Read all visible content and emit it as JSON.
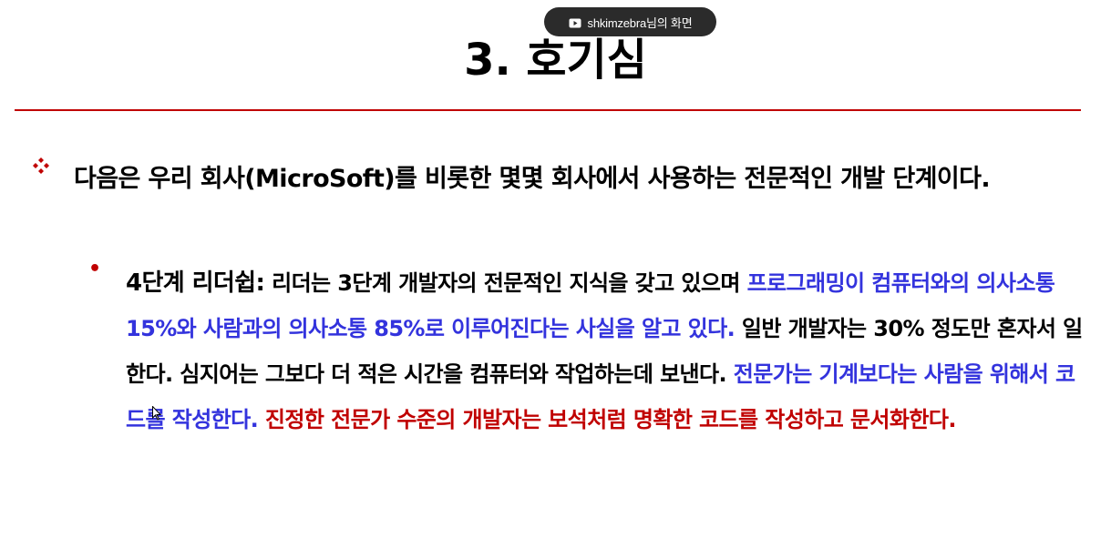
{
  "screen_share": {
    "label": "shkimzebra님의 화면",
    "icon": "screen-share-icon"
  },
  "slide": {
    "title": "3. 호기심",
    "bullet1": {
      "icon": "diamond-bullet-icon",
      "text": "다음은 우리 회사(MicroSoft)를 비롯한 몇몇 회사에서 사용하는 전문적인 개발 단계이다."
    },
    "bullet2": {
      "marker": "•",
      "heading": "4단계 리더쉽:",
      "text_black_1": " 리더는 3단계 개발자의 전문적인 지식을 갖고 있으며 ",
      "text_blue_1": "프로그래밍이 컴퓨터와의 의사소통 15%와 사람과의 의사소통 85%로 이루어진다는 사실을 알고 있다.",
      "text_black_2": " 일반 개발자는 30% 정도만 혼자서 일한다. 심지어는 그보다 더 적은 시간을 컴퓨터와 작업하는데 보낸다. ",
      "text_blue_2": "전문가는 기계보다는 사람을 위해서 코드를 작성한다.",
      "text_black_3": "  ",
      "text_red": "진정한 전문가 수준의 개발자는 보석처럼 명확한 코드를 작성하고 문서화한다."
    }
  },
  "colors": {
    "accent_red": "#c00000",
    "accent_blue": "#3333dd",
    "pill_bg": "#2b2b2b"
  }
}
